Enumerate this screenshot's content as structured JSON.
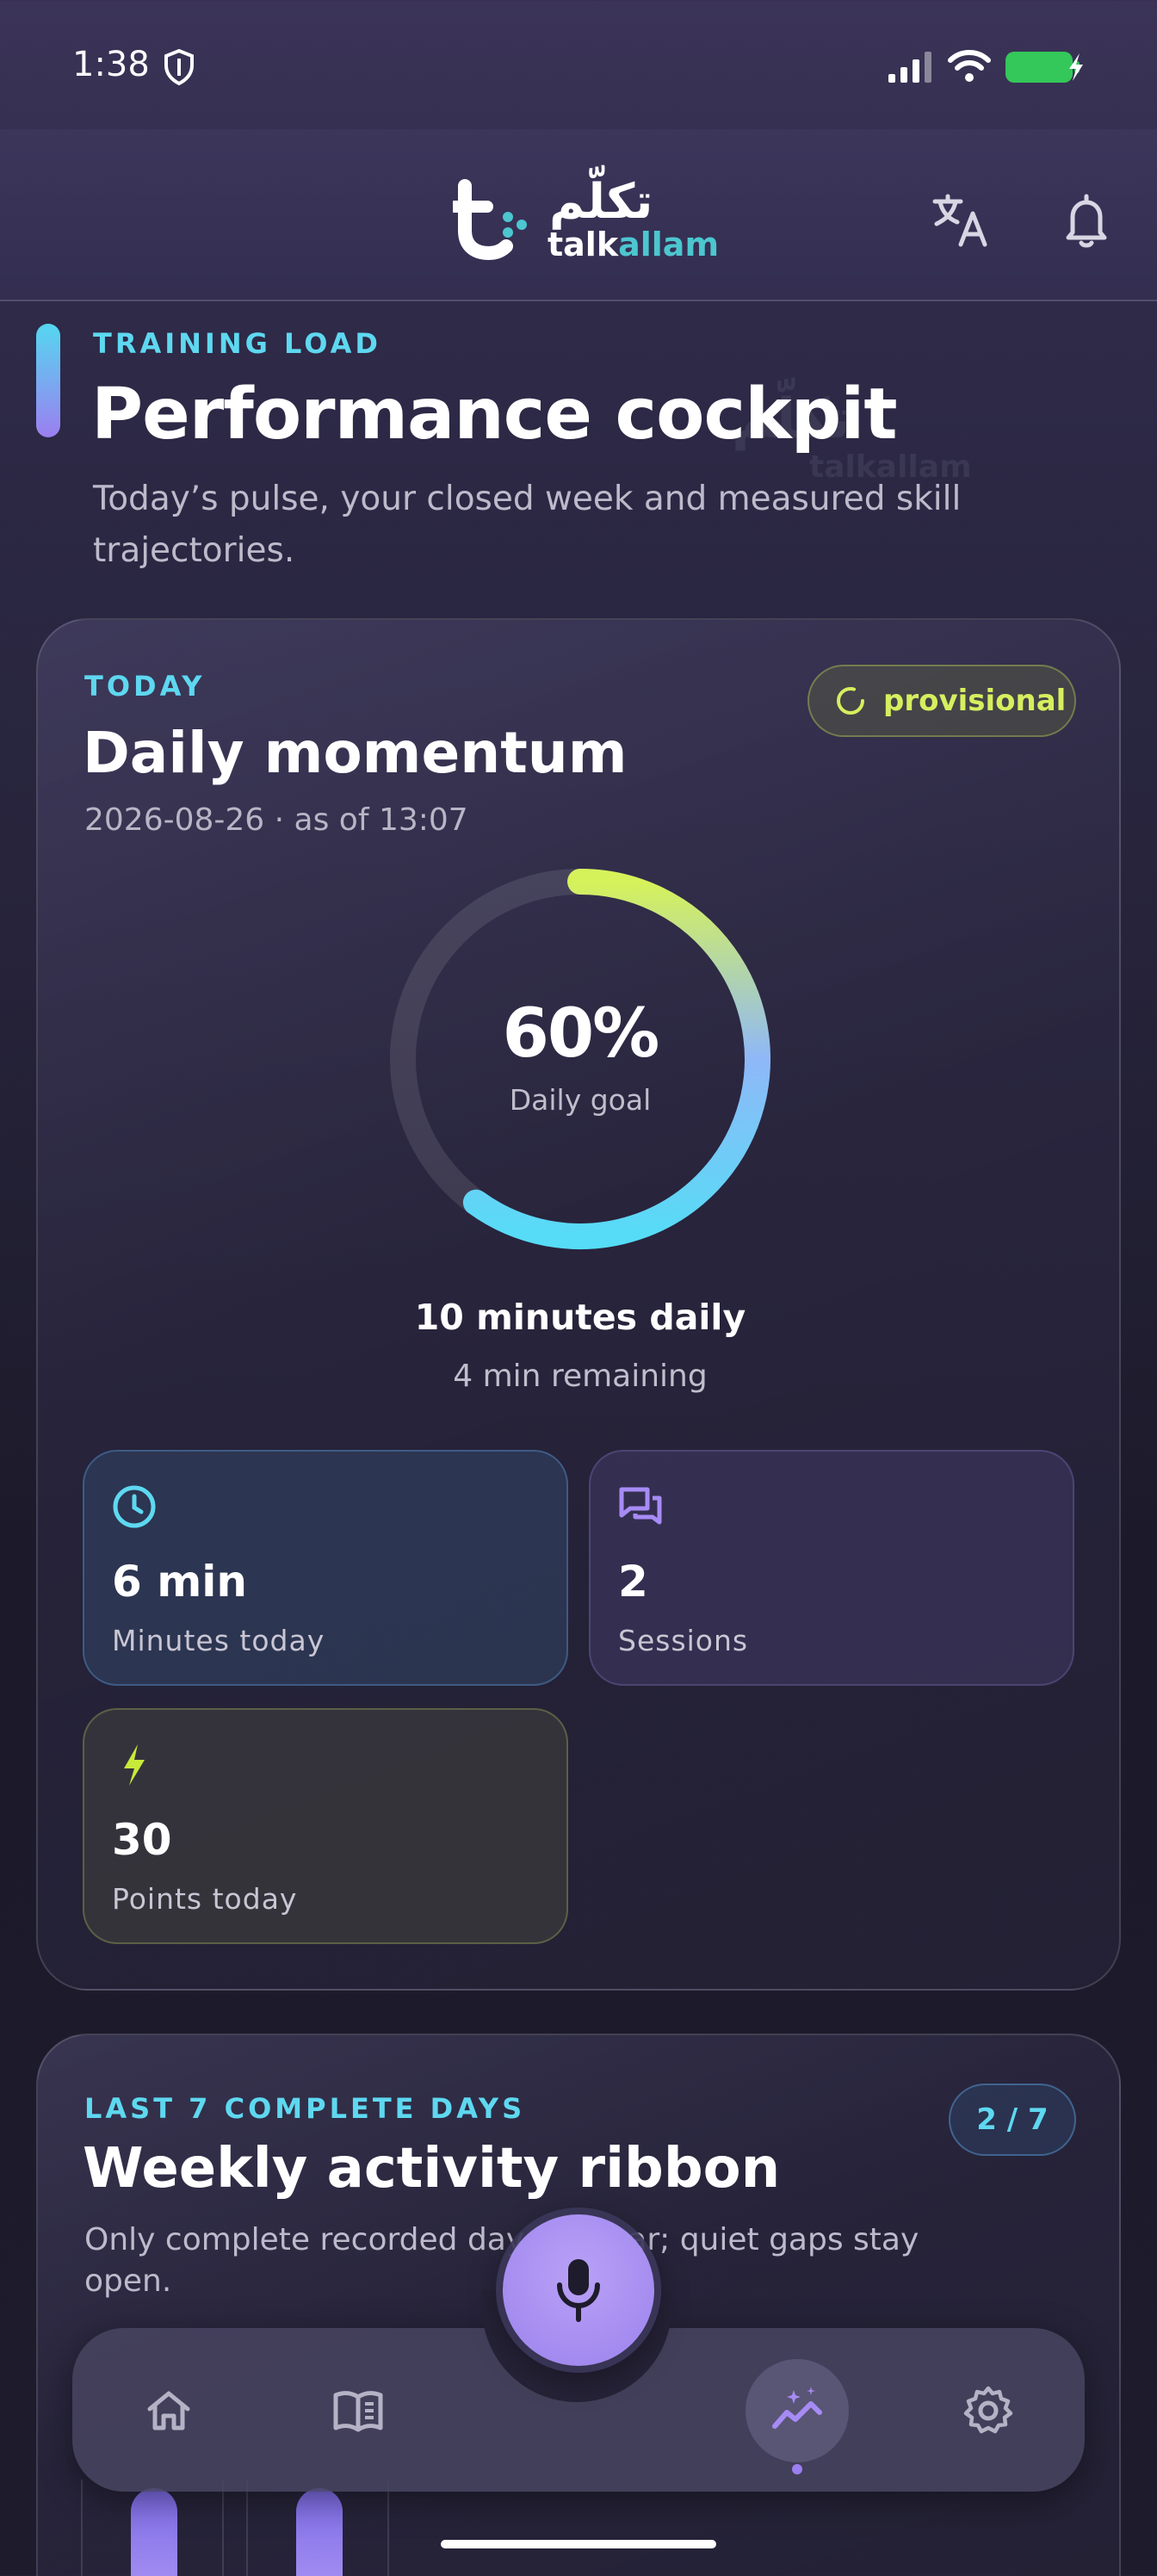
{
  "status_bar": {
    "time": "1:38"
  },
  "header": {
    "logo_arabic": "تكلّم",
    "logo_latin_a": "talk",
    "logo_latin_b": "allam"
  },
  "page": {
    "eyebrow": "TRAINING LOAD",
    "title": "Performance cockpit",
    "subtitle": "Today’s pulse, your closed week and measured skill trajectories."
  },
  "momentum": {
    "eyebrow": "TODAY",
    "title": "Daily momentum",
    "meta": "2026-08-26 · as of 13:07",
    "badge": "provisional",
    "progress_percent": 60,
    "progress_label": "60%",
    "progress_caption": "Daily goal",
    "goal_text": "10 minutes daily",
    "remaining_text": "4 min remaining",
    "stats": [
      {
        "value": "6 min",
        "label": "Minutes today",
        "icon": "clock-icon"
      },
      {
        "value": "2",
        "label": "Sessions",
        "icon": "chat-bubbles-icon"
      },
      {
        "value": "30",
        "label": "Points today",
        "icon": "lightning-icon"
      }
    ]
  },
  "weekly": {
    "eyebrow": "LAST 7 COMPLETE DAYS",
    "title": "Weekly activity ribbon",
    "description": "Only complete recorded days appear; quiet gaps stay open.",
    "count": "2 / 7"
  },
  "colors": {
    "accent_cyan": "#5ed8f0",
    "accent_lime": "#d6ef5e",
    "accent_purple": "#9b7ff0"
  }
}
